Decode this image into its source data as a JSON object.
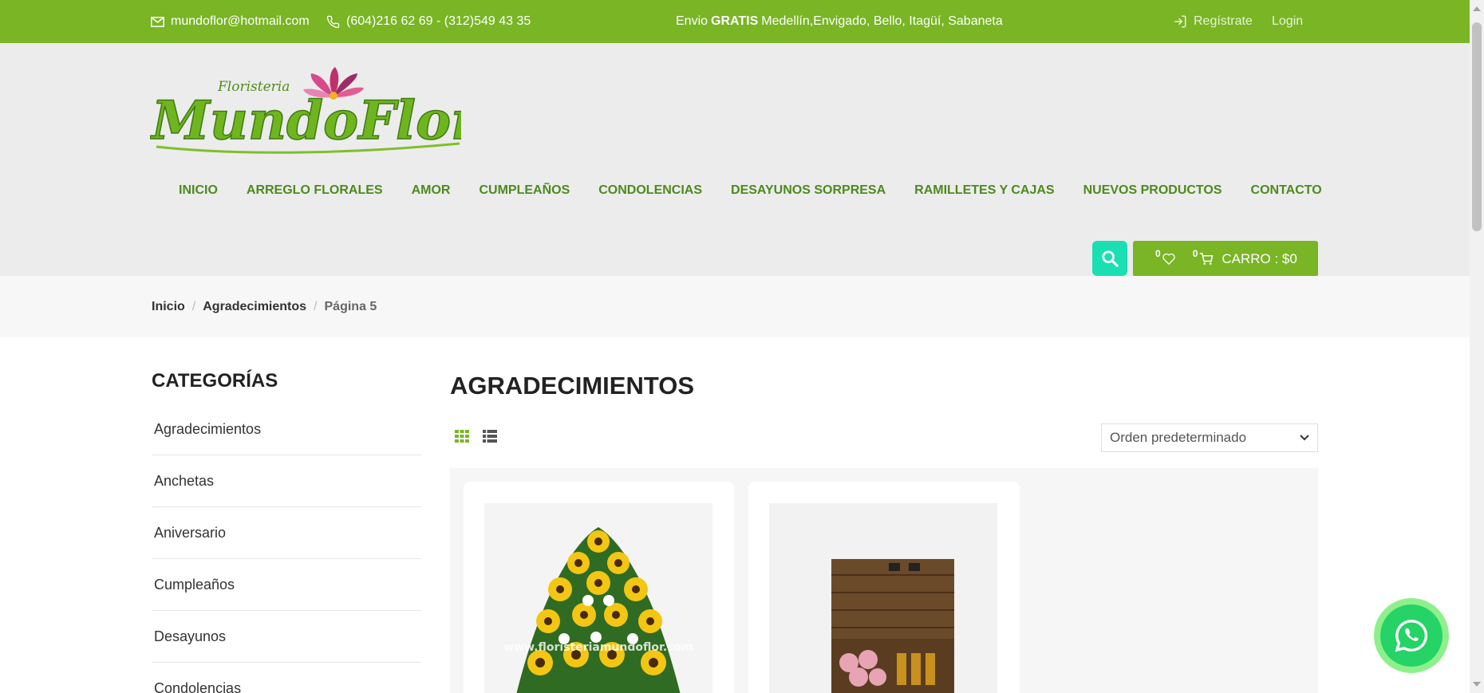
{
  "topbar": {
    "email": "mundoflor@hotmail.com",
    "phone": "(604)216 62 69 - (312)549 43 35",
    "promo_prefix": "Envio",
    "promo_bold": "GRATIS",
    "promo_suffix": "Medellín,Envigado, Bello, Itagüí, Sabaneta",
    "register": "Regístrate",
    "login": "Login"
  },
  "logo": {
    "small_text": "Floristeria",
    "main_text": "MundoFlor"
  },
  "nav": {
    "items": [
      "INICIO",
      "ARREGLO FLORALES",
      "AMOR",
      "CUMPLEAÑOS",
      "CONDOLENCIAS",
      "DESAYUNOS SORPRESA",
      "RAMILLETES Y CAJAS",
      "NUEVOS PRODUCTOS",
      "CONTACTO"
    ]
  },
  "cart": {
    "wishlist_count": "0",
    "cart_count": "0",
    "label": "CARRO : $0"
  },
  "breadcrumb": {
    "home": "Inicio",
    "category": "Agradecimientos",
    "current": "Página 5",
    "separator": "/"
  },
  "sidebar": {
    "title": "CATEGORÍAS",
    "items": [
      "Agradecimientos",
      "Anchetas",
      "Aniversario",
      "Cumpleaños",
      "Desayunos",
      "Condolencias"
    ]
  },
  "main": {
    "title": "AGRADECIMIENTOS",
    "sort_selected": "Orden predeterminado",
    "watermark": "www.floristeriamundoflor.com"
  },
  "colors": {
    "brand_green": "#79b524",
    "nav_green": "#4c8a1d",
    "search_teal": "#19dfb3",
    "whatsapp": "#25d366"
  }
}
